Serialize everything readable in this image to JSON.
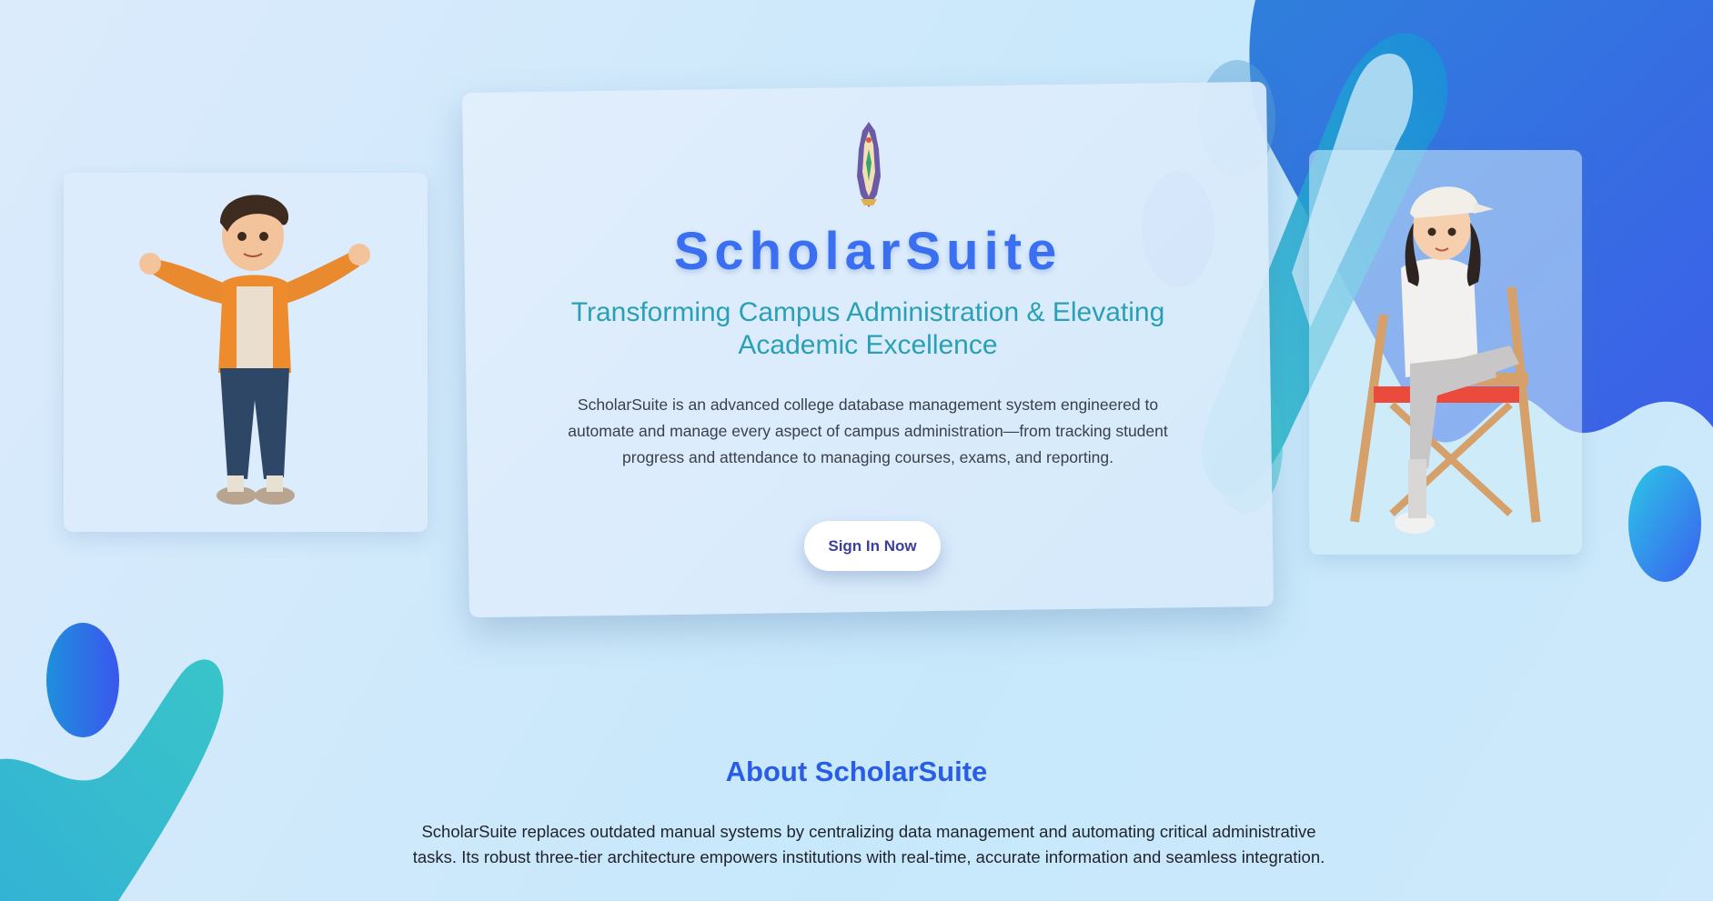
{
  "hero": {
    "title": "ScholarSuite",
    "subtitle": "Transforming Campus Administration & Elevating Academic Excellence",
    "description": "ScholarSuite is an advanced college database management system engineered to automate and manage every aspect of campus administration—from tracking student progress and attendance to managing courses, exams, and reporting.",
    "cta_label": "Sign In Now",
    "crest_icon": "college-crest-icon"
  },
  "about": {
    "title": "About ScholarSuite",
    "text": "ScholarSuite replaces outdated manual systems by centralizing data management and automating critical administrative tasks. Its robust three-tier architecture empowers institutions with real-time, accurate information and seamless integration."
  },
  "colors": {
    "title": "#3b6ff2",
    "subtitle": "#2aa0b6",
    "about_title": "#2a5de6",
    "cta_text": "#3d3f9c",
    "accent_blue": "#3b6ff2",
    "accent_teal": "#1fb5c6"
  },
  "images": {
    "left": "cartoon-boy-illustration",
    "right": "cartoon-girl-on-director-chair-illustration"
  }
}
